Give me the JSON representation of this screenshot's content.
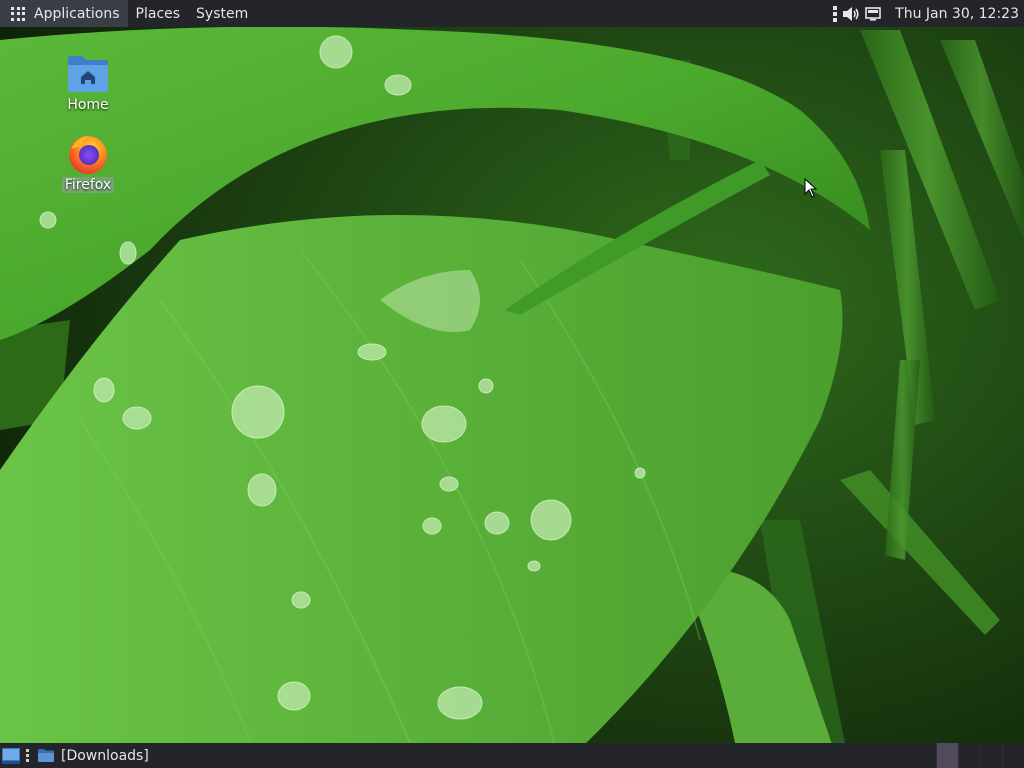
{
  "top_panel": {
    "applications_label": "Applications",
    "places_label": "Places",
    "system_label": "System",
    "clock": "Thu Jan 30, 12:23"
  },
  "desktop_icons": {
    "home_label": "Home",
    "firefox_label": "Firefox"
  },
  "bottom_panel": {
    "task_downloads_label": "[Downloads]"
  },
  "colors": {
    "panel_bg": "#23252b",
    "folder_blue": "#4a90d9",
    "active_workspace": "#514a5e"
  },
  "icons": [
    "apps-grid-icon",
    "kebab-menu-icon",
    "volume-icon",
    "display-icon",
    "home-folder-icon",
    "firefox-icon",
    "show-desktop-icon",
    "folder-icon",
    "mouse-pointer-icon"
  ]
}
